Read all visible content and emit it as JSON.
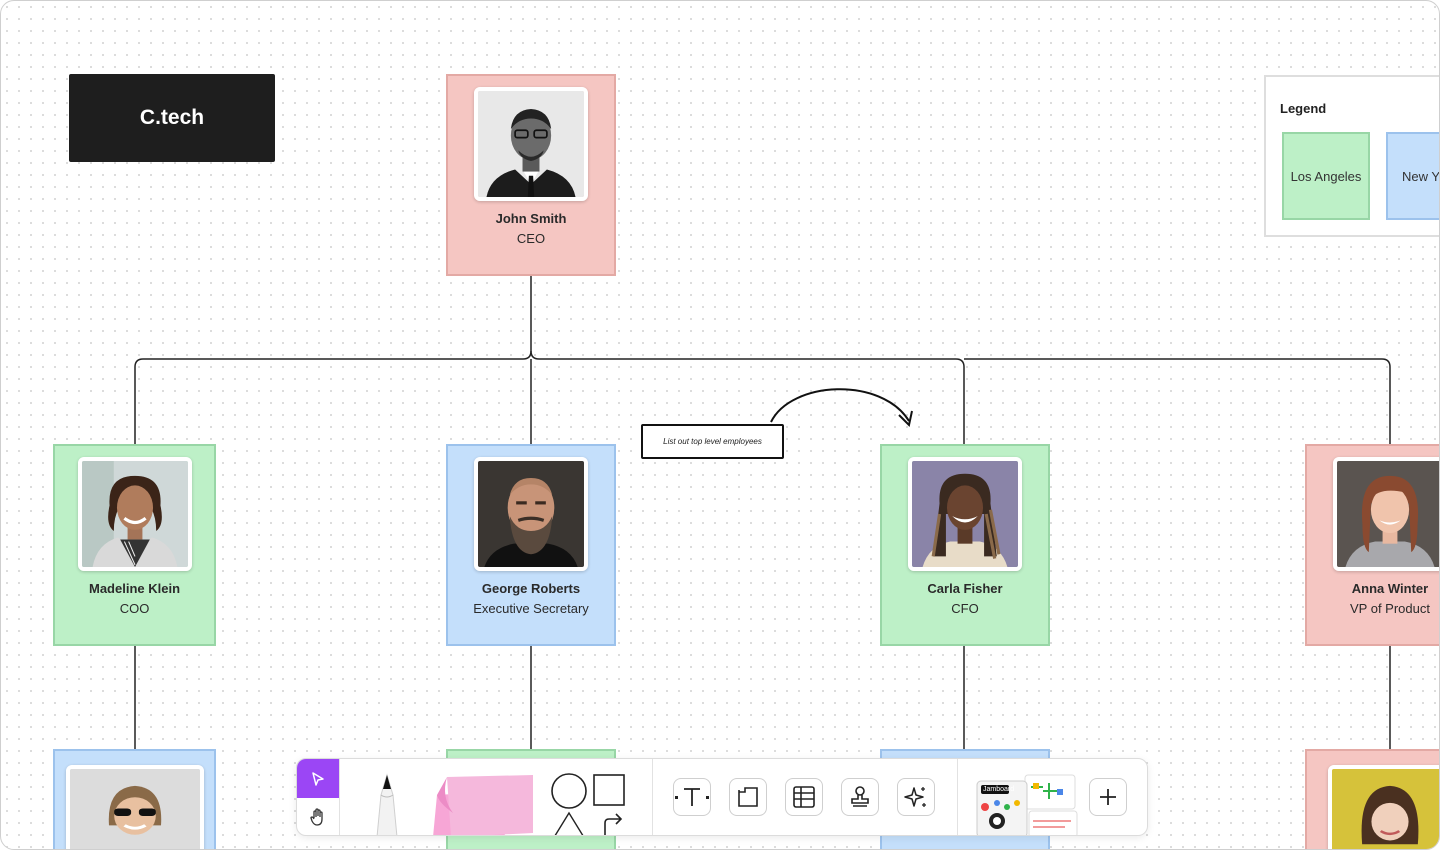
{
  "logo": {
    "text": "C.tech"
  },
  "people": {
    "ceo": {
      "name": "John Smith",
      "role": "CEO"
    },
    "coo": {
      "name": "Madeline Klein",
      "role": "COO"
    },
    "exec_sec": {
      "name": "George Roberts",
      "role": "Executive Secretary"
    },
    "cfo": {
      "name": "Carla Fisher",
      "role": "CFO"
    },
    "vp_product": {
      "name": "Anna Winter",
      "role": "VP of Product"
    }
  },
  "legend": {
    "title": "Legend",
    "items": [
      {
        "label": "Los Angeles",
        "color": "#bdf0c7"
      },
      {
        "label": "New Y",
        "color": "#c4dffb"
      }
    ]
  },
  "note": {
    "text": "List out top level employees"
  },
  "colors": {
    "pink": "#f5c6c2",
    "green": "#bdf0c7",
    "blue": "#c4dffb",
    "accent": "#9b46f5",
    "logo_bg": "#1e1e1e"
  },
  "toolbar": {
    "tools": [
      "select-icon",
      "hand-icon",
      "marker-icon",
      "sticky-note-icon",
      "circle-icon",
      "square-icon",
      "triangle-icon",
      "arrow-icon",
      "text-icon",
      "frame-icon",
      "table-icon",
      "stamp-icon",
      "sparkle-icon",
      "templates-icon",
      "plus-icon"
    ],
    "template_badge": "Jamboard"
  }
}
